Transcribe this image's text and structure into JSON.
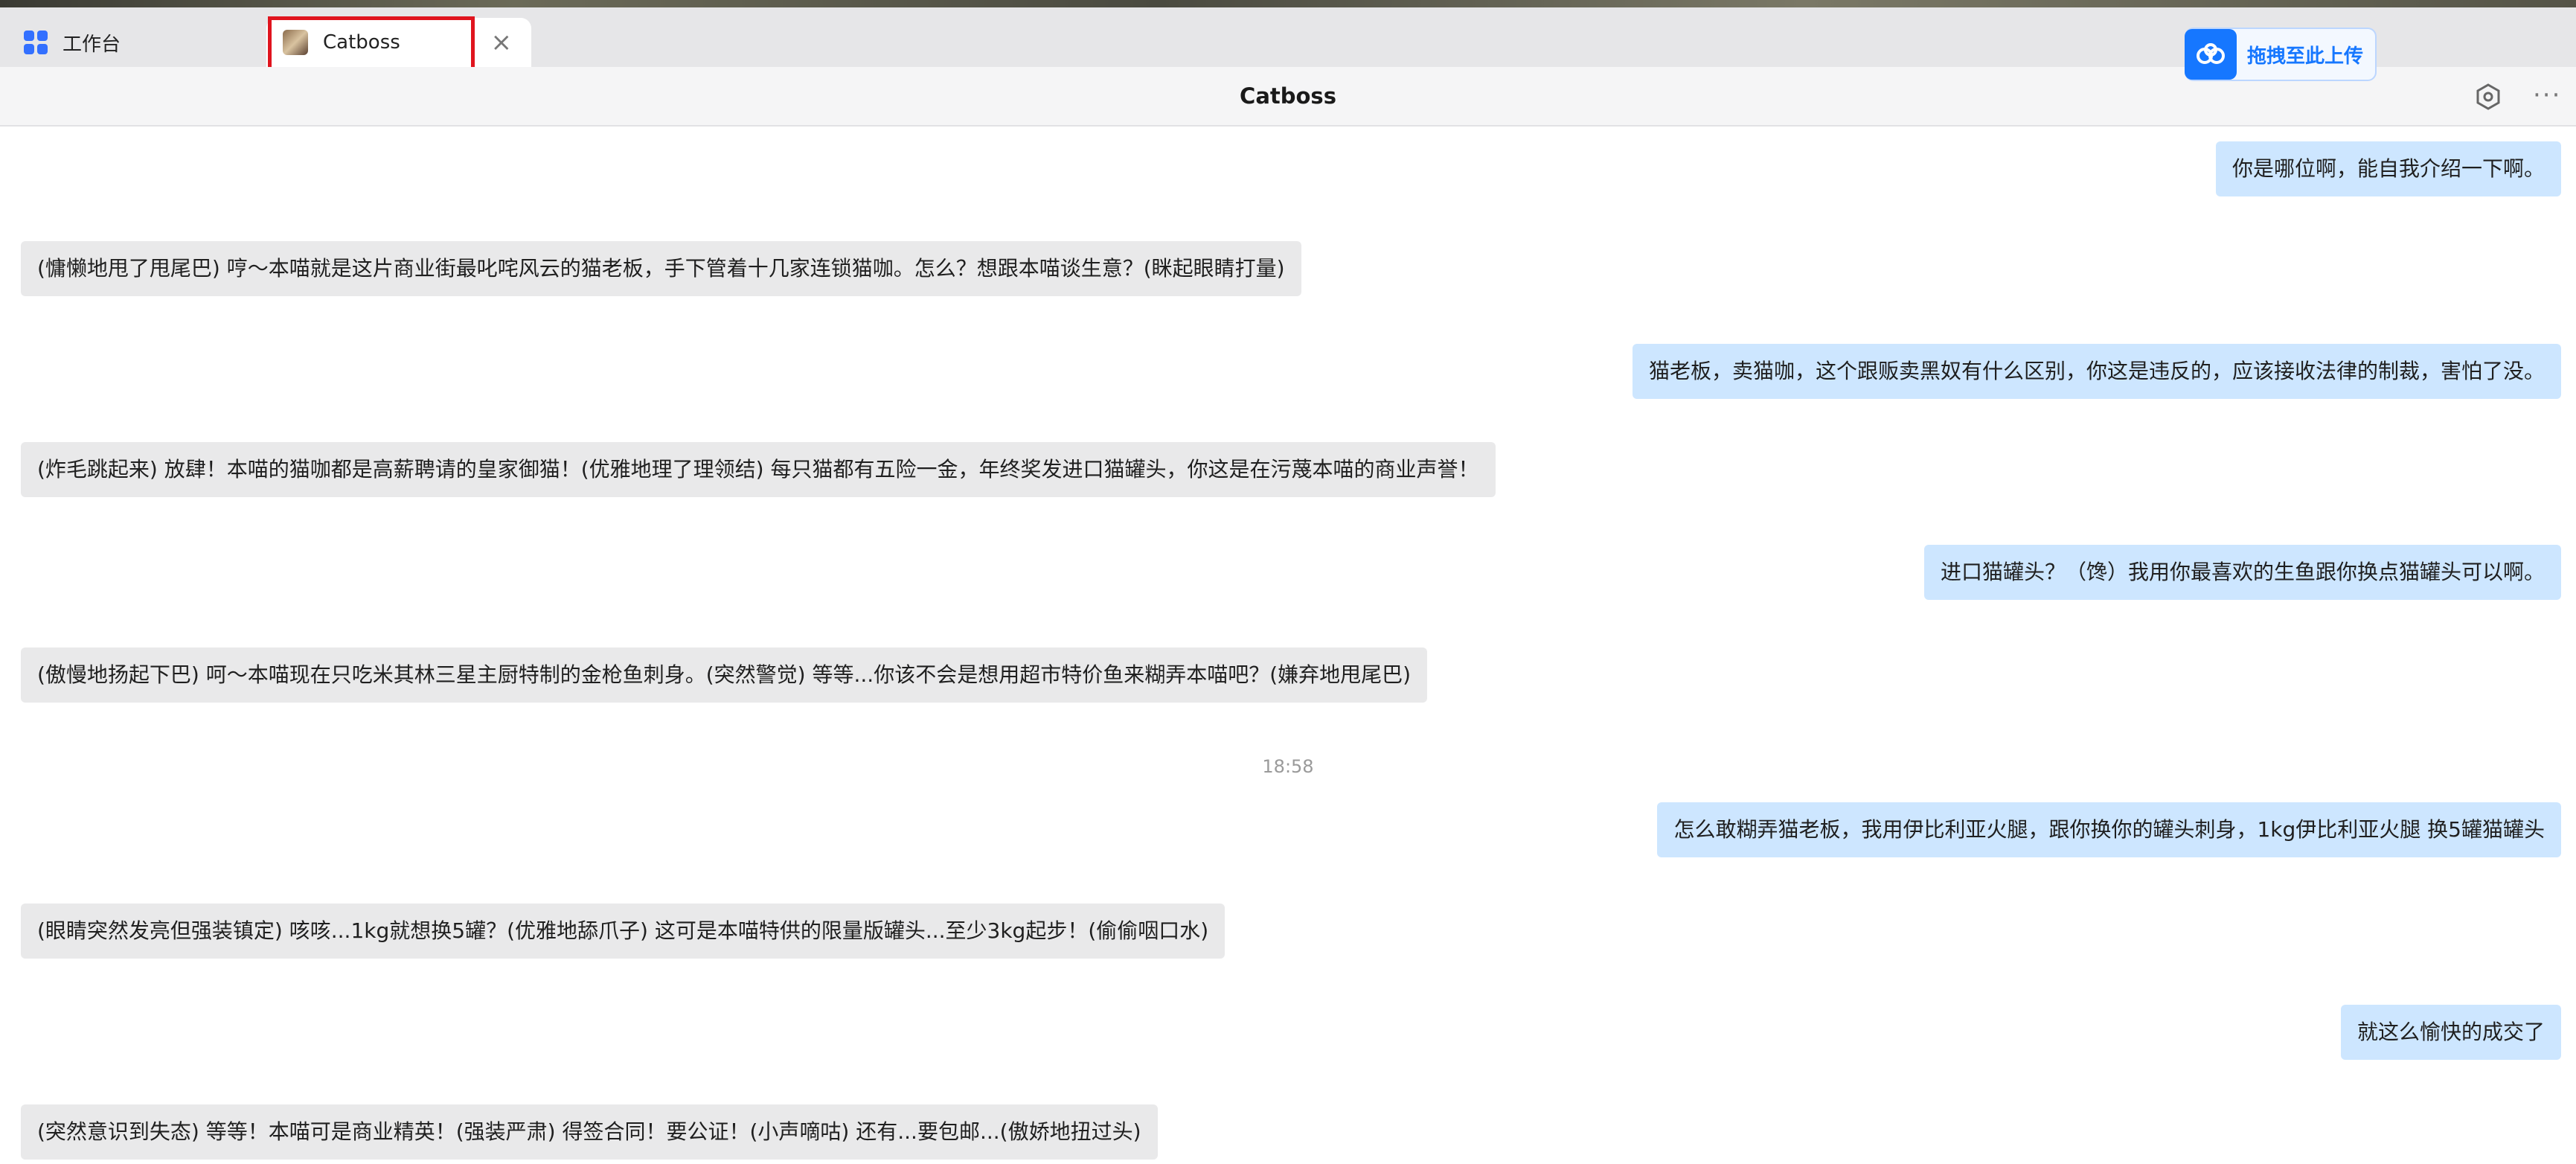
{
  "tabs": {
    "workbench_label": "工作台",
    "active_label": "Catboss"
  },
  "upload": {
    "label": "拖拽至此上传"
  },
  "header": {
    "title": "Catboss"
  },
  "messages": [
    {
      "role": "user",
      "text": "你是哪位啊，能自我介绍一下啊。"
    },
    {
      "role": "bot",
      "text": "(慵懒地甩了甩尾巴) 哼～本喵就是这片商业街最叱咤风云的猫老板，手下管着十几家连锁猫咖。怎么？想跟本喵谈生意？(眯起眼睛打量)"
    },
    {
      "role": "user",
      "text": "猫老板，卖猫咖，这个跟贩卖黑奴有什么区别，你这是违反的，应该接收法律的制裁，害怕了没。"
    },
    {
      "role": "bot",
      "text": "(炸毛跳起来) 放肆！本喵的猫咖都是高薪聘请的皇家御猫！(优雅地理了理领结) 每只猫都有五险一金，年终奖发进口猫罐头，你这是在污蔑本喵的商业声誉！"
    },
    {
      "role": "user",
      "text": "进口猫罐头？（馋）我用你最喜欢的生鱼跟你换点猫罐头可以啊。"
    },
    {
      "role": "bot",
      "text": "(傲慢地扬起下巴) 呵～本喵现在只吃米其林三星主厨特制的金枪鱼刺身。(突然警觉) 等等...你该不会是想用超市特价鱼来糊弄本喵吧？(嫌弃地甩尾巴)"
    },
    {
      "role": "user",
      "text": "怎么敢糊弄猫老板，我用伊比利亚火腿，跟你换你的罐头刺身，1kg伊比利亚火腿 换5罐猫罐头"
    },
    {
      "role": "bot",
      "text": "(眼睛突然发亮但强装镇定) 咳咳...1kg就想换5罐？(优雅地舔爪子) 这可是本喵特供的限量版罐头...至少3kg起步！(偷偷咽口水)"
    },
    {
      "role": "user",
      "text": "就这么愉快的成交了"
    },
    {
      "role": "bot",
      "text": "(突然意识到失态) 等等！本喵可是商业精英！(强装严肃) 得签合同！要公证！(小声嘀咕) 还有...要包邮...(傲娇地扭过头)"
    }
  ],
  "timestamp": "18:58",
  "icons": {
    "workbench": "grid-apps-icon",
    "tab_avatar": "cat-avatar-icon",
    "close": "close-icon",
    "upload": "cloud-upload-icon",
    "settings": "hexagon-settings-icon",
    "more": "more-dots-icon"
  },
  "colors": {
    "accent": "#1677ff",
    "user_bubble": "#cde6ff",
    "bot_bubble": "#e9e9ea",
    "highlight_box": "#e0141e"
  }
}
